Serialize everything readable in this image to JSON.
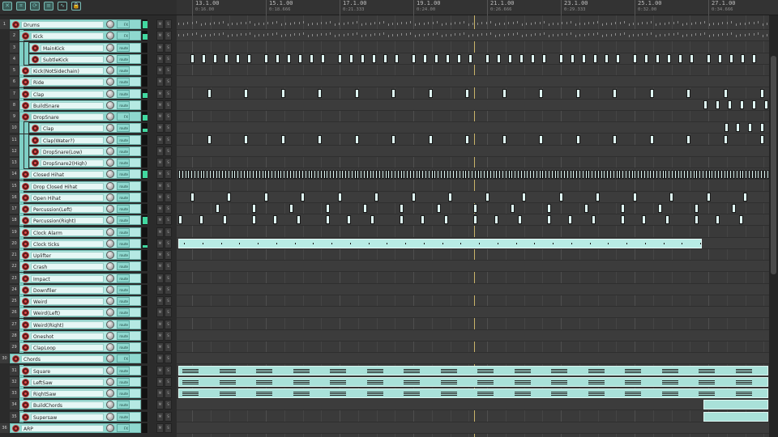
{
  "toolbar": {
    "buttons": [
      {
        "name": "crossfade-icon",
        "glyph": "✕"
      },
      {
        "name": "grid-snap-icon",
        "glyph": "⌗"
      },
      {
        "name": "loop-icon",
        "glyph": "⟳"
      },
      {
        "name": "ripple-icon",
        "glyph": "≡"
      },
      {
        "name": "envelope-lock-icon",
        "glyph": "∿"
      },
      {
        "name": "lock-icon",
        "glyph": "🔒"
      }
    ]
  },
  "ruler": {
    "marks": [
      {
        "bar": "13.1.00",
        "time": "0:16.00"
      },
      {
        "bar": "15.1.00",
        "time": "0:18.666"
      },
      {
        "bar": "17.1.00",
        "time": "0:21.333"
      },
      {
        "bar": "19.1.00",
        "time": "0:24.00"
      },
      {
        "bar": "21.1.00",
        "time": "0:26.666"
      },
      {
        "bar": "23.1.00",
        "time": "0:29.333"
      },
      {
        "bar": "25.1.00",
        "time": "0:32.00"
      },
      {
        "bar": "27.1.00",
        "time": "0:34.666"
      }
    ]
  },
  "tracks": [
    {
      "num": "1",
      "name": "Drums",
      "folder": true,
      "depth": 0
    },
    {
      "num": "2",
      "name": "Kick",
      "folder": true,
      "depth": 1
    },
    {
      "num": "3",
      "name": "MainKick",
      "depth": 2
    },
    {
      "num": "4",
      "name": "SubtleKick",
      "depth": 2
    },
    {
      "num": "5",
      "name": "Kick(NotSidechain)",
      "depth": 1
    },
    {
      "num": "6",
      "name": "Ride",
      "depth": 1
    },
    {
      "num": "7",
      "name": "Clap",
      "depth": 1
    },
    {
      "num": "8",
      "name": "BuildSnare",
      "depth": 1
    },
    {
      "num": "9",
      "name": "DropSnare",
      "folder": true,
      "depth": 1
    },
    {
      "num": "10",
      "name": "Clap",
      "depth": 2
    },
    {
      "num": "11",
      "name": "Clap(Water?)",
      "depth": 2
    },
    {
      "num": "12",
      "name": "DropSnare(Low)",
      "depth": 2
    },
    {
      "num": "13",
      "name": "DropSnare2(High)",
      "depth": 2
    },
    {
      "num": "14",
      "name": "Closed Hihat",
      "depth": 1
    },
    {
      "num": "15",
      "name": "Drop Closed Hihat",
      "depth": 1
    },
    {
      "num": "16",
      "name": "Open Hihat",
      "depth": 1
    },
    {
      "num": "17",
      "name": "Percussion(Left)",
      "depth": 1
    },
    {
      "num": "18",
      "name": "Percussion(Right)",
      "depth": 1
    },
    {
      "num": "19",
      "name": "Clock Alarm",
      "depth": 1
    },
    {
      "num": "20",
      "name": "Clock ticks",
      "depth": 1
    },
    {
      "num": "21",
      "name": "Uplifter",
      "depth": 1
    },
    {
      "num": "22",
      "name": "Crash",
      "depth": 1
    },
    {
      "num": "23",
      "name": "Impact",
      "depth": 1
    },
    {
      "num": "24",
      "name": "Downfiler",
      "depth": 1
    },
    {
      "num": "25",
      "name": "Weird",
      "depth": 1
    },
    {
      "num": "26",
      "name": "Weird(Left)",
      "depth": 1
    },
    {
      "num": "27",
      "name": "Weird(Right)",
      "depth": 1
    },
    {
      "num": "28",
      "name": "Oneshot",
      "depth": 1
    },
    {
      "num": "29",
      "name": "ClapLoop",
      "depth": 1
    },
    {
      "num": "30",
      "name": "Chords",
      "folder": true,
      "depth": 0
    },
    {
      "num": "31",
      "name": "Square",
      "depth": 1
    },
    {
      "num": "32",
      "name": "LeftSaw",
      "depth": 1
    },
    {
      "num": "33",
      "name": "RightSaw",
      "depth": 1
    },
    {
      "num": "34",
      "name": "BuildChords",
      "depth": 1
    },
    {
      "num": "35",
      "name": "Supersaw",
      "depth": 1
    },
    {
      "num": "36",
      "name": "ARP",
      "folder": true,
      "depth": 0
    }
  ],
  "fx_label": "FX",
  "mute_label": "M",
  "solo_label": "S",
  "route_label": "route",
  "accent_color": "#8fd8cf",
  "playhead_color": "#c9b46a"
}
